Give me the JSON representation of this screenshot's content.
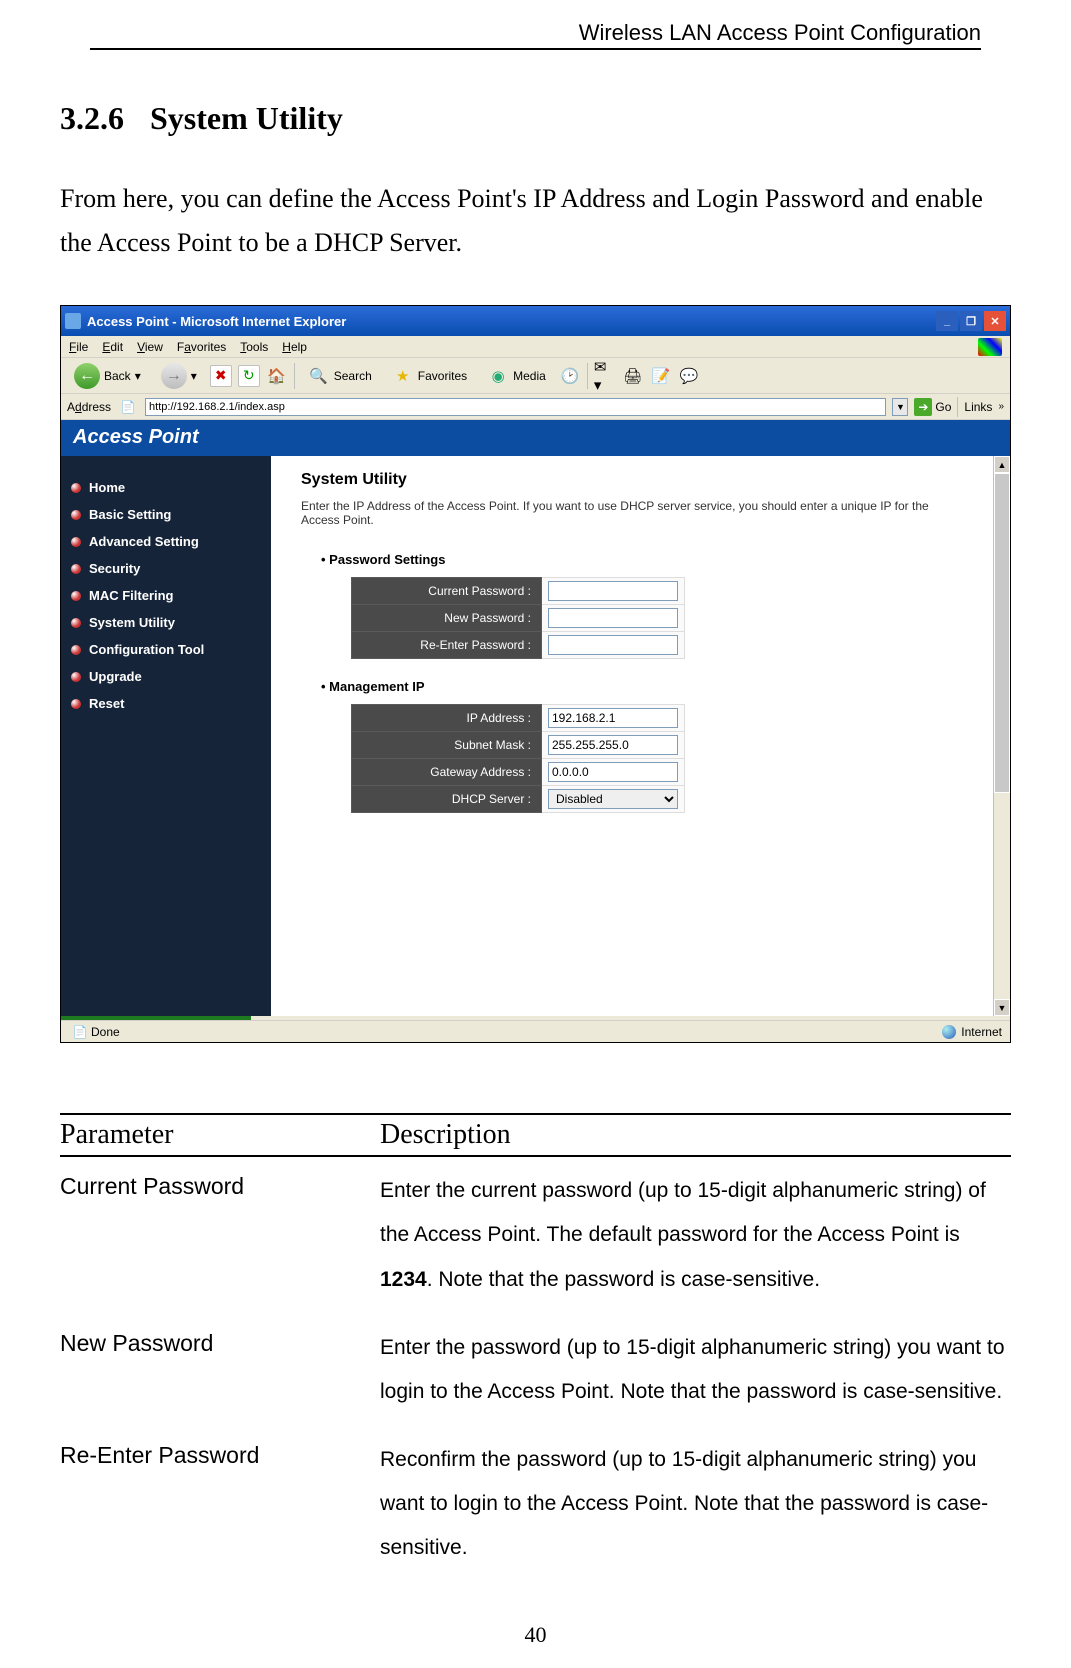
{
  "running_head": "Wireless LAN Access Point Configuration",
  "section": {
    "number": "3.2.6",
    "title": "System Utility"
  },
  "intro": "From here, you can define the Access Point's IP Address and Login Password and enable the Access Point to be a DHCP Server.",
  "ie": {
    "title": "Access Point - Microsoft Internet Explorer",
    "menu": {
      "file": "File",
      "edit": "Edit",
      "view": "View",
      "fav": "Favorites",
      "tools": "Tools",
      "help": "Help"
    },
    "toolbar": {
      "back": "Back",
      "search": "Search",
      "favorites": "Favorites",
      "media": "Media"
    },
    "addr_label": "Address",
    "addr_value": "http://192.168.2.1/index.asp",
    "go": "Go",
    "links": "Links",
    "status_left": "Done",
    "status_right": "Internet"
  },
  "ap": {
    "brand": "Access Point",
    "menu": [
      "Home",
      "Basic Setting",
      "Advanced Setting",
      "Security",
      "MAC Filtering",
      "System Utility",
      "Configuration Tool",
      "Upgrade",
      "Reset"
    ],
    "content": {
      "title": "System Utility",
      "desc": "Enter the IP Address of the Access Point. If you want to use DHCP server service, you should enter a unique IP for the Access Point.",
      "pw_section": "Password Settings",
      "pw_labels": {
        "current": "Current Password :",
        "new": "New Password :",
        "re": "Re-Enter Password :"
      },
      "ip_section": "Management IP",
      "ip_labels": {
        "ip": "IP Address :",
        "mask": "Subnet Mask :",
        "gw": "Gateway Address :",
        "dhcp": "DHCP Server :"
      },
      "ip_values": {
        "ip": "192.168.2.1",
        "mask": "255.255.255.0",
        "gw": "0.0.0.0",
        "dhcp": "Disabled"
      }
    }
  },
  "param_table": {
    "h1": "Parameter",
    "h2": "Description",
    "rows": [
      {
        "p": "Current Password",
        "d_pre": "Enter the current password (up to 15-digit alphanumeric string) of the Access Point. The default password for the Access Point is ",
        "d_bold": "1234",
        "d_post": ". Note that the password is case-sensitive."
      },
      {
        "p": "New Password",
        "d_pre": "Enter the password (up to 15-digit alphanumeric string) you want to login to the Access Point. Note that the password is case-sensitive.",
        "d_bold": "",
        "d_post": ""
      },
      {
        "p": "Re-Enter Password",
        "d_pre": "Reconfirm the password (up to 15-digit alphanumeric string) you want to login to the Access Point. Note that the password is case-sensitive.",
        "d_bold": "",
        "d_post": ""
      }
    ]
  },
  "page_number": "40"
}
